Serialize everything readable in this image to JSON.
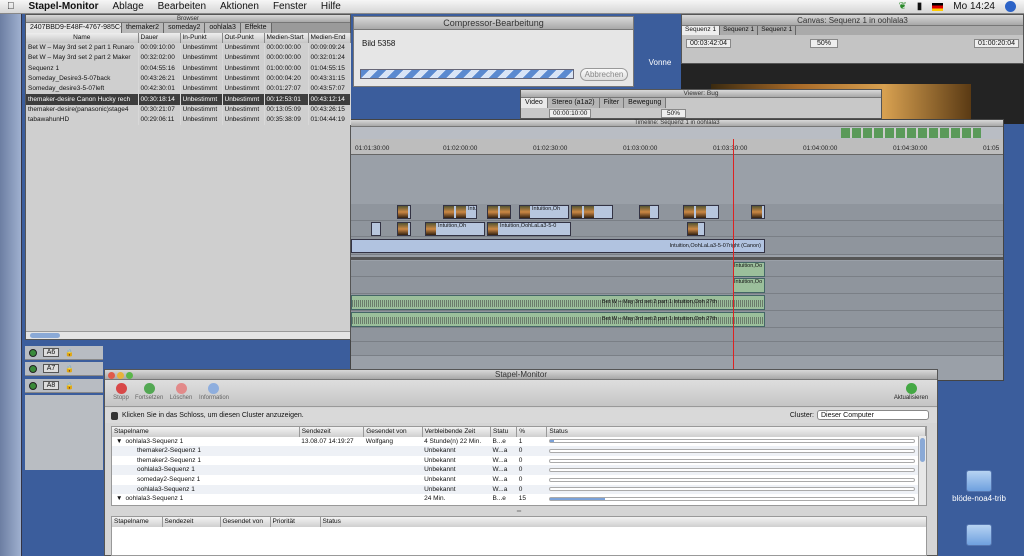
{
  "menubar": {
    "app": "Stapel-Monitor",
    "items": [
      "Ablage",
      "Bearbeiten",
      "Aktionen",
      "Fenster",
      "Hilfe"
    ],
    "clock": "Mo 14:24"
  },
  "browser": {
    "title": "Browser",
    "tabs": [
      "2407BBD9-E48F-4767-985C-18",
      "themaker2",
      "someday2",
      "oohlala3",
      "Effekte"
    ],
    "columns": [
      "Name",
      "Dauer",
      "In-Punkt",
      "Out-Punkt",
      "Medien-Start",
      "Medien-End"
    ],
    "rows": [
      [
        "Bet W – May 3rd set 2 part 1 Runaro",
        "00:09:10:00",
        "Unbestimmt",
        "Unbestimmt",
        "00:00:00:00",
        "00:09:09:24"
      ],
      [
        "Bet W – May 3rd set 2 part 2 Maker",
        "00:32:02:00",
        "Unbestimmt",
        "Unbestimmt",
        "00:00:00:00",
        "00:32:01:24"
      ],
      [
        "Sequenz 1",
        "00:04:55:16",
        "Unbestimmt",
        "Unbestimmt",
        "01:00:00:00",
        "01:04:55:15"
      ],
      [
        "Someday_Desire3-5-07back",
        "00:43:26:21",
        "Unbestimmt",
        "Unbestimmt",
        "00:00:04:20",
        "00:43:31:15"
      ],
      [
        "Someday_desire3-5-07left",
        "00:42:30:01",
        "Unbestimmt",
        "Unbestimmt",
        "00:01:27:07",
        "00:43:57:07"
      ],
      [
        "themaker-desire Canon Hucky rech",
        "00:30:18:14",
        "Unbestimmt",
        "Unbestimmt",
        "00:12:53:01",
        "00:43:12:14"
      ],
      [
        "themaker-desire(panasonic)stage4",
        "00:30:21:07",
        "Unbestimmt",
        "Unbestimmt",
        "00:13:05:09",
        "00:43:26:15"
      ],
      [
        "tabawahunHD",
        "00:29:06:11",
        "Unbestimmt",
        "Unbestimmt",
        "00:35:38:09",
        "01:04:44:19"
      ]
    ]
  },
  "compressor": {
    "title": "Compressor-Bearbeitung",
    "status": "Bild 5358",
    "progress": 0.82,
    "cancel_label": "Abbrechen"
  },
  "canvas": {
    "title": "Canvas: Sequenz 1 in oohlala3",
    "tabs": [
      "Sequenz 1",
      "Sequenz 1",
      "Sequenz 1"
    ],
    "timecode_left": "00:03:42:04",
    "zoom": "50%",
    "timecode_right": "01:00:20:04"
  },
  "viewer": {
    "title": "Viewer: Bug",
    "tabs": [
      "Video",
      "Stereo (a1a2)",
      "Filter",
      "Bewegung"
    ],
    "timecode": "00:00:10:00",
    "zoom": "50%"
  },
  "timeline": {
    "title": "Timeline: Sequenz 1 in oohlala3",
    "ruler": [
      "01:01:30:00",
      "01:02:00:00",
      "01:02:30:00",
      "01:03:00:00",
      "01:03:30:00",
      "01:04:00:00",
      "01:04:30:00",
      "01:05"
    ],
    "clip_labels": {
      "intuition": "Intuition,Oh",
      "intuition_long": "Intuition,OohLaLa3-5-0",
      "canon": "Intuition,OohLaLa3-5-07right (Canon)",
      "audio": "Bet W – May 3rd set 2 part 1 Intuition,Ooh 2?th",
      "short": "Intuition,Oo"
    },
    "track_heads": [
      "A6",
      "A7",
      "A8"
    ]
  },
  "stapel": {
    "title": "Stapel-Monitor",
    "toolbar": [
      {
        "label": "Stopp",
        "color": "#d84848"
      },
      {
        "label": "Fortsetzen",
        "color": "#53a853"
      },
      {
        "label": "Löschen",
        "color": "#d86060"
      },
      {
        "label": "Information",
        "color": "#5a8ad6"
      }
    ],
    "refresh_label": "Aktualisieren",
    "lock_hint": "Klicken Sie in das Schloss, um diesen Cluster anzuzeigen.",
    "cluster_label": "Cluster:",
    "cluster_value": "Dieser Computer",
    "columns": [
      "Stapelname",
      "Sendezeit",
      "Gesendet von",
      "Verbleibende Zeit",
      "Statu",
      "%",
      "Status"
    ],
    "rows": [
      {
        "name": "oohlala3-Sequenz 1",
        "sent": "13.08.07 14:19:27",
        "by": "Wolfgang",
        "remaining": "4 Stunde(n) 22 Min.",
        "statu": "B...e",
        "pct": "1",
        "bar": 0.01,
        "indent": 0,
        "tri": "▼"
      },
      {
        "name": "themaker2-Sequenz 1",
        "sent": "",
        "by": "",
        "remaining": "Unbekannt",
        "statu": "W...a",
        "pct": "0",
        "bar": 0,
        "indent": 1,
        "tri": ""
      },
      {
        "name": "themaker2-Sequenz 1",
        "sent": "",
        "by": "",
        "remaining": "Unbekannt",
        "statu": "W...a",
        "pct": "0",
        "bar": 0,
        "indent": 1,
        "tri": ""
      },
      {
        "name": "oohlala3-Sequenz 1",
        "sent": "",
        "by": "",
        "remaining": "Unbekannt",
        "statu": "W...a",
        "pct": "0",
        "bar": 0,
        "indent": 1,
        "tri": ""
      },
      {
        "name": "someday2-Sequenz 1",
        "sent": "",
        "by": "",
        "remaining": "Unbekannt",
        "statu": "W...a",
        "pct": "0",
        "bar": 0,
        "indent": 1,
        "tri": ""
      },
      {
        "name": "oohlala3-Sequenz 1",
        "sent": "",
        "by": "",
        "remaining": "Unbekannt",
        "statu": "W...a",
        "pct": "0",
        "bar": 0,
        "indent": 1,
        "tri": ""
      },
      {
        "name": "oohlala3-Sequenz 1",
        "sent": "",
        "by": "",
        "remaining": "24 Min.",
        "statu": "B...e",
        "pct": "15",
        "bar": 0.15,
        "indent": 0,
        "tri": "▼"
      }
    ],
    "lower_columns": [
      "Stapelname",
      "Sendezeit",
      "Gesendet von",
      "Priorität",
      "Status"
    ]
  },
  "desktop": {
    "label_top": "Vonne",
    "label_icon": "blöde-noa4-trib"
  }
}
